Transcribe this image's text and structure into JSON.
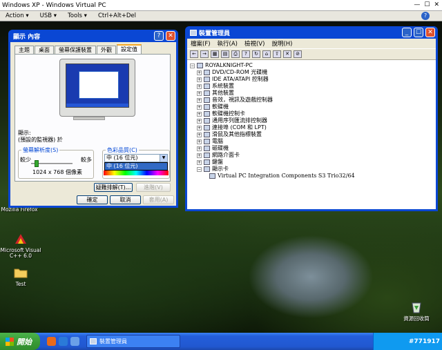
{
  "host": {
    "title": "Windows XP - Windows Virtual PC",
    "menu": [
      "Action ▾",
      "USB ▾",
      "Tools ▾",
      "Ctrl+Alt+Del"
    ],
    "help_icon": "?"
  },
  "desktop_icons": [
    {
      "name": "firefox",
      "label": "Mozilla Firefox"
    },
    {
      "name": "vcpp",
      "label": "Microsoft Visual C++ 6.0"
    },
    {
      "name": "test",
      "label": "Test"
    },
    {
      "name": "recycle",
      "label": "資源回收筒"
    }
  ],
  "display_dialog": {
    "title": "顯示 內容",
    "tabs": [
      "主題",
      "桌面",
      "螢幕保護裝置",
      "外觀",
      "設定值"
    ],
    "active_tab": "設定值",
    "display_label": "顯示:",
    "display_value": "(預設的監視器) 於",
    "resolution_group": "螢幕解析度(S)",
    "less": "較少",
    "more": "較多",
    "resolution_value": "1024 x 768 個像素",
    "resolution_level": 0.1,
    "color_group": "色彩品質(C)",
    "color_selected": "中 (16 位元)",
    "color_options": [
      "中 (16 位元)"
    ],
    "troubleshoot_button": "疑難排解(T)...",
    "advanced_button": "進階(V)",
    "ok_button": "確定",
    "cancel_button": "取消",
    "apply_button": "套用(A)"
  },
  "device_manager": {
    "title": "裝置管理員",
    "menu": [
      "檔案(F)",
      "執行(A)",
      "檢視(V)",
      "說明(H)"
    ],
    "root": "ROYALKNIGHT-PC",
    "items": [
      "DVD/CD-ROM 光碟機",
      "IDE ATA/ATAPI 控制器",
      "系統裝置",
      "其他裝置",
      "音效，視訊及遊戲控制器",
      "軟碟機",
      "軟碟機控制卡",
      "通用序列匯流排控制器",
      "連接埠 (COM 和 LPT)",
      "滑鼠及其他指標裝置",
      "電腦",
      "磁碟機",
      "網路介面卡",
      "鍵盤",
      "顯示卡"
    ],
    "expanded_child": "Virtual PC Integration Components S3 Trio32/64"
  },
  "taskbar": {
    "start_label": "開始",
    "task_label": "裝置管理員",
    "tray_text": "#771917"
  }
}
